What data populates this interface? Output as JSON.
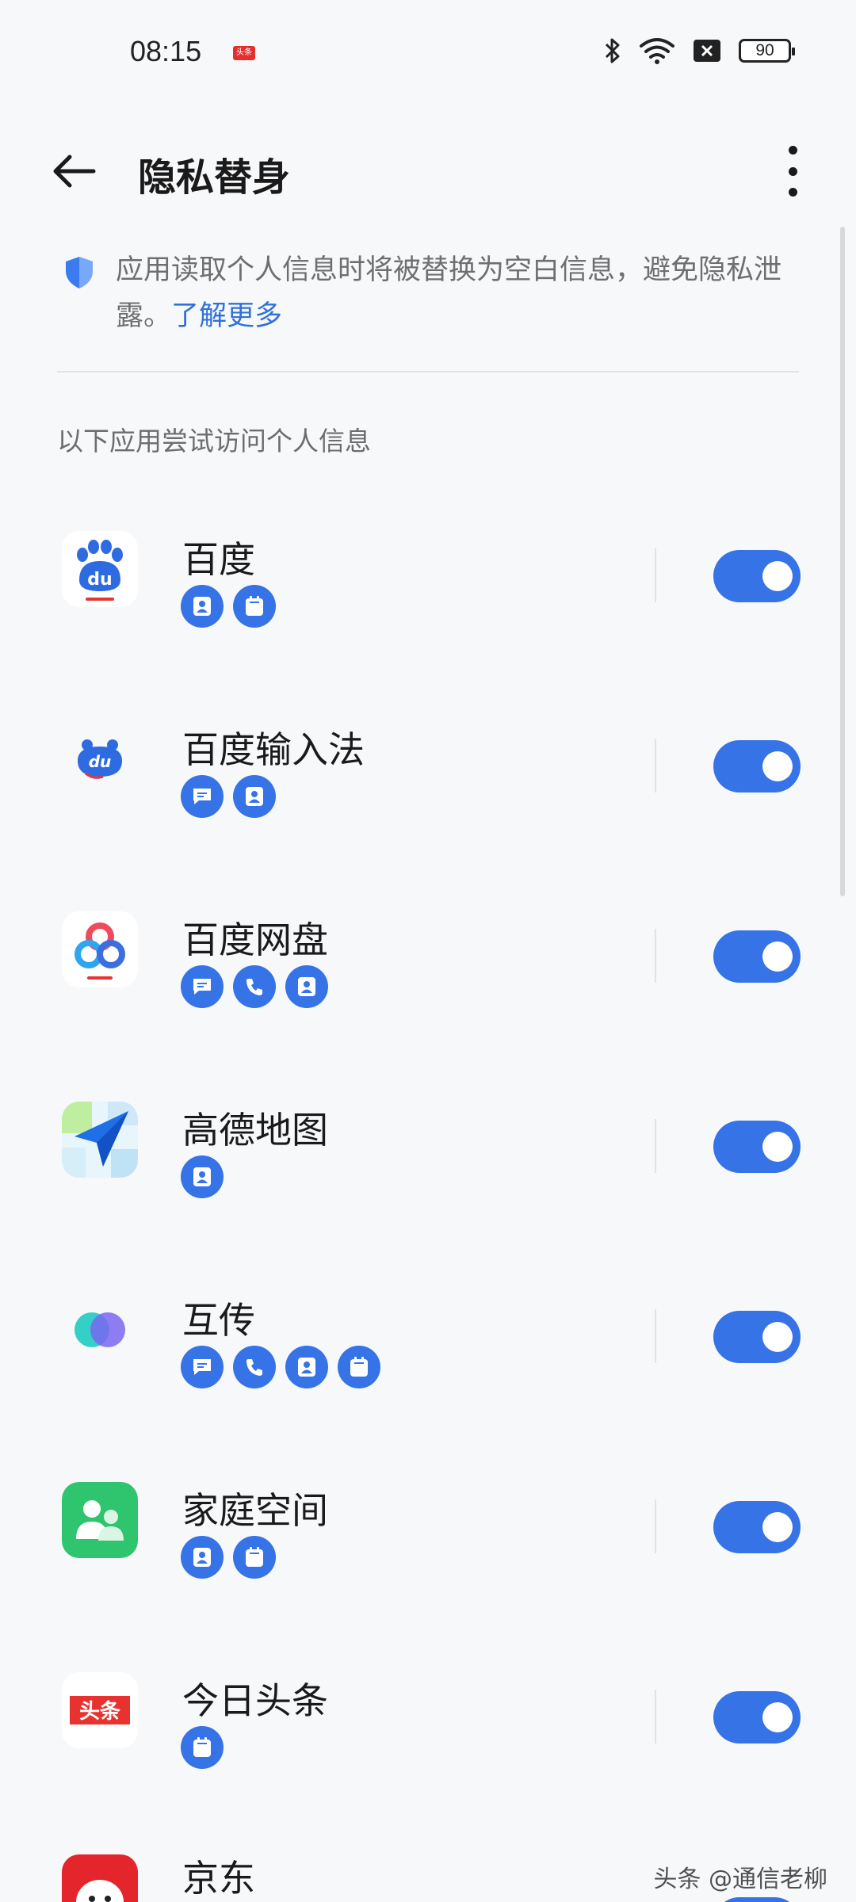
{
  "status_bar": {
    "time": "08:15",
    "news_badge": "头条",
    "battery": "90",
    "icons": [
      "bluetooth-icon",
      "wifi-icon",
      "sim-off-icon",
      "battery-icon"
    ]
  },
  "header": {
    "title": "隐私替身"
  },
  "notice": {
    "text": "应用读取个人信息时将被替换为空白信息，避免隐私泄露。",
    "link": "了解更多"
  },
  "section_label": "以下应用尝试访问个人信息",
  "apps": [
    {
      "name": "百度",
      "permissions": [
        "contacts-icon",
        "calendar-icon"
      ],
      "enabled": true
    },
    {
      "name": "百度输入法",
      "permissions": [
        "message-icon",
        "contacts-icon"
      ],
      "enabled": true
    },
    {
      "name": "百度网盘",
      "permissions": [
        "message-icon",
        "phone-icon",
        "contacts-icon"
      ],
      "enabled": true
    },
    {
      "name": "高德地图",
      "permissions": [
        "contacts-icon"
      ],
      "enabled": true
    },
    {
      "name": "互传",
      "permissions": [
        "message-icon",
        "phone-icon",
        "contacts-icon",
        "calendar-icon"
      ],
      "enabled": true
    },
    {
      "name": "家庭空间",
      "permissions": [
        "contacts-icon",
        "calendar-icon"
      ],
      "enabled": true
    },
    {
      "name": "今日头条",
      "permissions": [
        "calendar-icon"
      ],
      "enabled": true
    },
    {
      "name": "京东",
      "permissions": [],
      "enabled": true
    }
  ],
  "app_icon_labels": {
    "baidu": "du",
    "baidu_input": "du",
    "toutiao": "头条"
  },
  "watermark": "头条 @通信老柳",
  "colors": {
    "accent": "#3573e6",
    "background": "#f7f8fa",
    "link": "#3270d9"
  }
}
